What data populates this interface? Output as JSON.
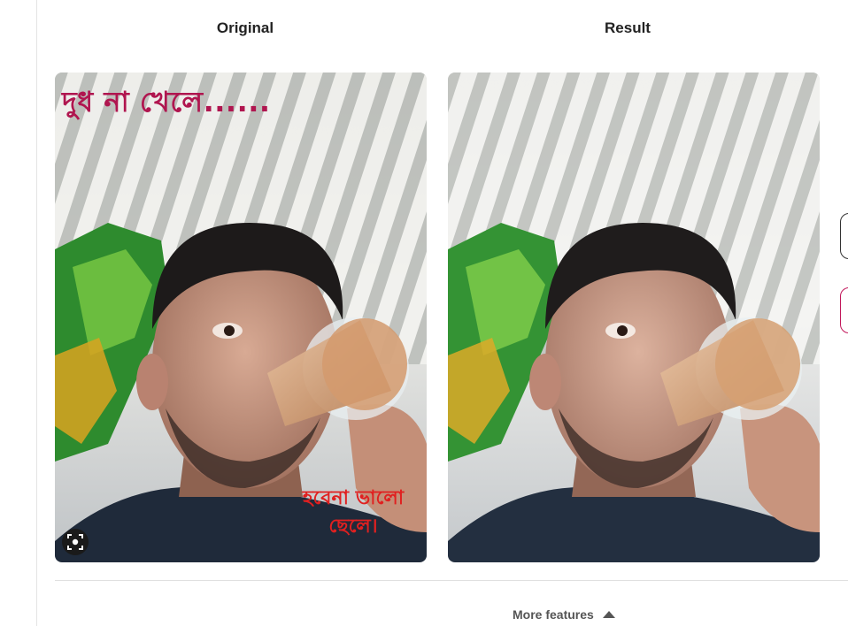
{
  "columns": {
    "original_label": "Original",
    "result_label": "Result"
  },
  "original_overlay": {
    "top_text": "দুধ না খেলে......",
    "bottom_text_line1": "হবেনা ভালো",
    "bottom_text_line2": "ছেলে।"
  },
  "footer": {
    "more_features_label": "More features"
  },
  "icons": {
    "lens": "visual-search-icon",
    "caret": "caret-up-icon"
  },
  "colors": {
    "overlay_top_text": "#b0154f",
    "overlay_bottom_text": "#e02020",
    "edge_button_accent": "#c2185b"
  }
}
